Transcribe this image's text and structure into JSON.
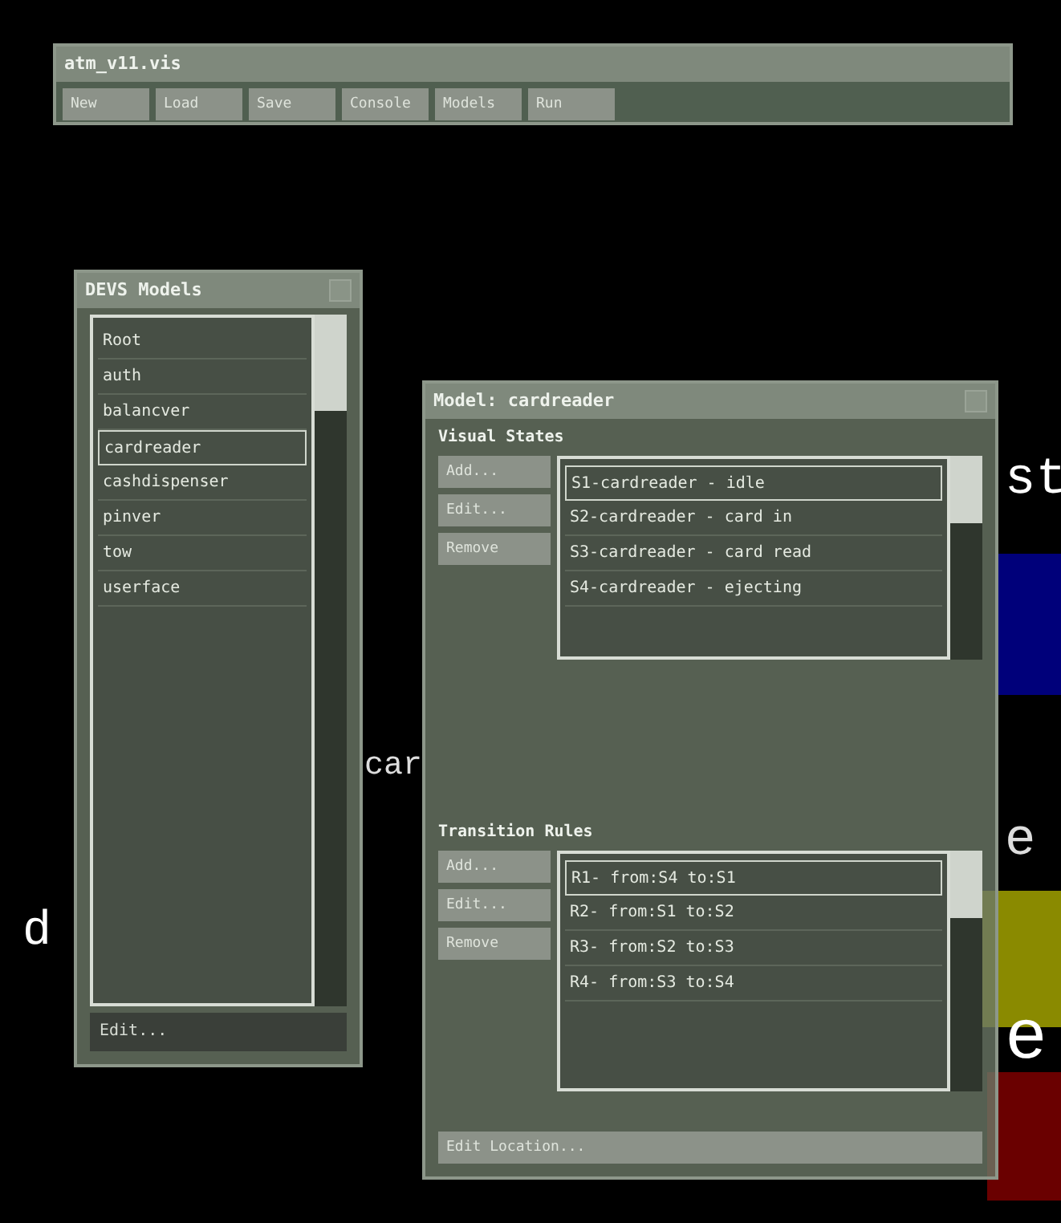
{
  "scene_labels": [
    {
      "text": "st"
    },
    {
      "text": "car"
    },
    {
      "text": "e"
    },
    {
      "text": "e"
    },
    {
      "text": "d"
    }
  ],
  "toolbar_window": {
    "title": "atm_v11.vis",
    "buttons": [
      "New",
      "Load",
      "Save",
      "Console",
      "Models",
      "Run"
    ]
  },
  "models_window": {
    "title": "DEVS Models",
    "items": [
      {
        "label": "Root",
        "selected": false
      },
      {
        "label": "auth",
        "selected": false
      },
      {
        "label": "balancver",
        "selected": false
      },
      {
        "label": "cardreader",
        "selected": true
      },
      {
        "label": "cashdispenser",
        "selected": false
      },
      {
        "label": "pinver",
        "selected": false
      },
      {
        "label": "tow",
        "selected": false
      },
      {
        "label": "userface",
        "selected": false
      }
    ],
    "footer_button": "Edit..."
  },
  "model_window": {
    "title": "Model: cardreader",
    "visual_states": {
      "heading": "Visual States",
      "buttons": [
        "Add...",
        "Edit...",
        "Remove"
      ],
      "items": [
        {
          "label": "S1-cardreader - idle",
          "selected": true
        },
        {
          "label": "S2-cardreader - card in",
          "selected": false
        },
        {
          "label": "S3-cardreader - card read",
          "selected": false
        },
        {
          "label": "S4-cardreader - ejecting",
          "selected": false
        }
      ]
    },
    "transition_rules": {
      "heading": "Transition Rules",
      "buttons": [
        "Add...",
        "Edit...",
        "Remove"
      ],
      "items": [
        {
          "label": "R1- from:S4 to:S1",
          "selected": true
        },
        {
          "label": "R2- from:S1 to:S2",
          "selected": false
        },
        {
          "label": "R3- from:S2 to:S3",
          "selected": false
        },
        {
          "label": "R4- from:S3 to:S4",
          "selected": false
        }
      ]
    },
    "footer_button": "Edit Location..."
  }
}
